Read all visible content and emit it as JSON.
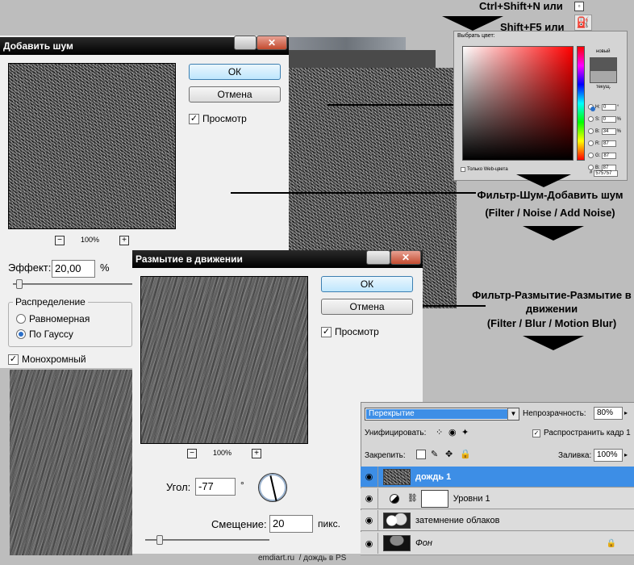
{
  "shortcuts": {
    "line1": "Ctrl+Shift+N или",
    "line2": "Shift+F5 или"
  },
  "noise_dialog": {
    "title": "Добавить шум",
    "ok": "ОК",
    "cancel": "Отмена",
    "preview": "Просмотр",
    "zoom": "100%",
    "effect_label": "Эффект:",
    "effect_value": "20,00",
    "effect_unit": "%",
    "distribution_label": "Распределение",
    "uniform": "Равномерная",
    "gaussian": "По Гауссу",
    "monochrome": "Монохромный"
  },
  "color_picker": {
    "title": "Выбрать цвет:",
    "new_label": "новый",
    "current_label": "текущ.",
    "web_only": "Только Web-цвета",
    "fields": [
      {
        "label": "H:",
        "value": "0",
        "unit": "°"
      },
      {
        "label": "S:",
        "value": "0",
        "unit": "%"
      },
      {
        "label": "B:",
        "value": "34",
        "unit": "%"
      },
      {
        "label": "R:",
        "value": "87",
        "unit": ""
      },
      {
        "label": "G:",
        "value": "87",
        "unit": ""
      },
      {
        "label": "B:",
        "value": "87",
        "unit": ""
      }
    ],
    "hex_label": "#",
    "hex": "575757",
    "swatch_color": "#575757"
  },
  "annotations": {
    "noise": {
      "line1": "Фильтр-Шум-Добавить шум",
      "line2": "(Filter / Noise / Add Noise)"
    },
    "blur": {
      "line1": "Фильтр-Размытие-Размытие в",
      "line2": "движении",
      "line3": "(Filter / Blur / Motion Blur)"
    }
  },
  "blur_dialog": {
    "title": "Размытие в движении",
    "ok": "ОК",
    "cancel": "Отмена",
    "preview": "Просмотр",
    "zoom": "100%",
    "angle_label": "Угол:",
    "angle_value": "-77",
    "angle_unit": "°",
    "offset_label": "Смещение:",
    "offset_value": "20",
    "offset_unit": "пикс."
  },
  "layers_panel": {
    "blend_mode": "Перекрытие",
    "opacity_label": "Непрозрачность:",
    "opacity_value": "80%",
    "unify_label": "Унифицировать:",
    "propagate_label": "Распространить кадр 1",
    "lock_label": "Закрепить:",
    "fill_label": "Заливка:",
    "fill_value": "100%",
    "layers": [
      {
        "name": "дождь 1",
        "selected": true
      },
      {
        "name": "Уровни 1",
        "selected": false
      },
      {
        "name": "затемнение облаков",
        "selected": false
      },
      {
        "name": "Фон",
        "selected": false
      }
    ],
    "accent": "#3d8ee6"
  },
  "footer": "emdiart.ru  / дождь в PS"
}
